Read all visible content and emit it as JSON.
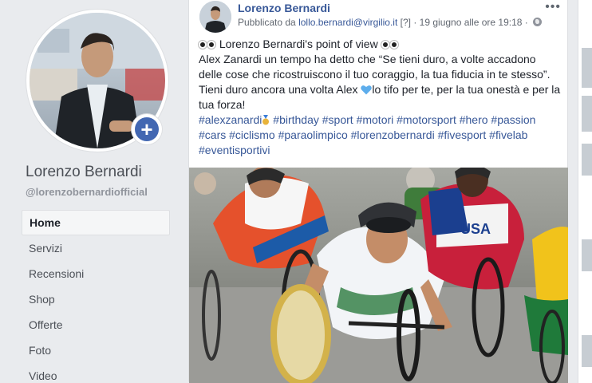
{
  "page": {
    "name": "Lorenzo Bernardi",
    "handle": "@lorenzobernardiofficial"
  },
  "nav": [
    {
      "label": "Home",
      "active": true
    },
    {
      "label": "Servizi",
      "active": false
    },
    {
      "label": "Recensioni",
      "active": false
    },
    {
      "label": "Shop",
      "active": false
    },
    {
      "label": "Offerte",
      "active": false
    },
    {
      "label": "Foto",
      "active": false
    },
    {
      "label": "Video",
      "active": false
    }
  ],
  "post": {
    "author": "Lorenzo Bernardi",
    "meta_prefix": "Pubblicato da",
    "meta_email": "lollo.bernardi@virgilio.it",
    "meta_flag": "[?]",
    "meta_time": "· 19 giugno alle ore 19:18 ·",
    "more_label": "•••",
    "title_line": "Lorenzo Bernardi's point of view",
    "line1": "Alex Zanardi un tempo ha detto che “Se tieni duro, a volte accadono delle cose che ricostruiscono il tuo coraggio, la tua fiducia in te stesso”.",
    "line2a": "Tieni duro ancora una volta Alex",
    "line2b": "lo tifo per te, per la tua onestà e per la tua forza!",
    "tag_first": "#alexzanardi",
    "tags_rest": "#birthday #sport #motori #motorsport #hero #passion #cars #ciclismo #paraolimpico #lorenzobernardi #fivesport #fivelab #eventisportivi",
    "photo_jersey_text": "USA"
  },
  "colors": {
    "link": "#385898",
    "accent": "#4267b2",
    "background": "#e9ebee"
  }
}
